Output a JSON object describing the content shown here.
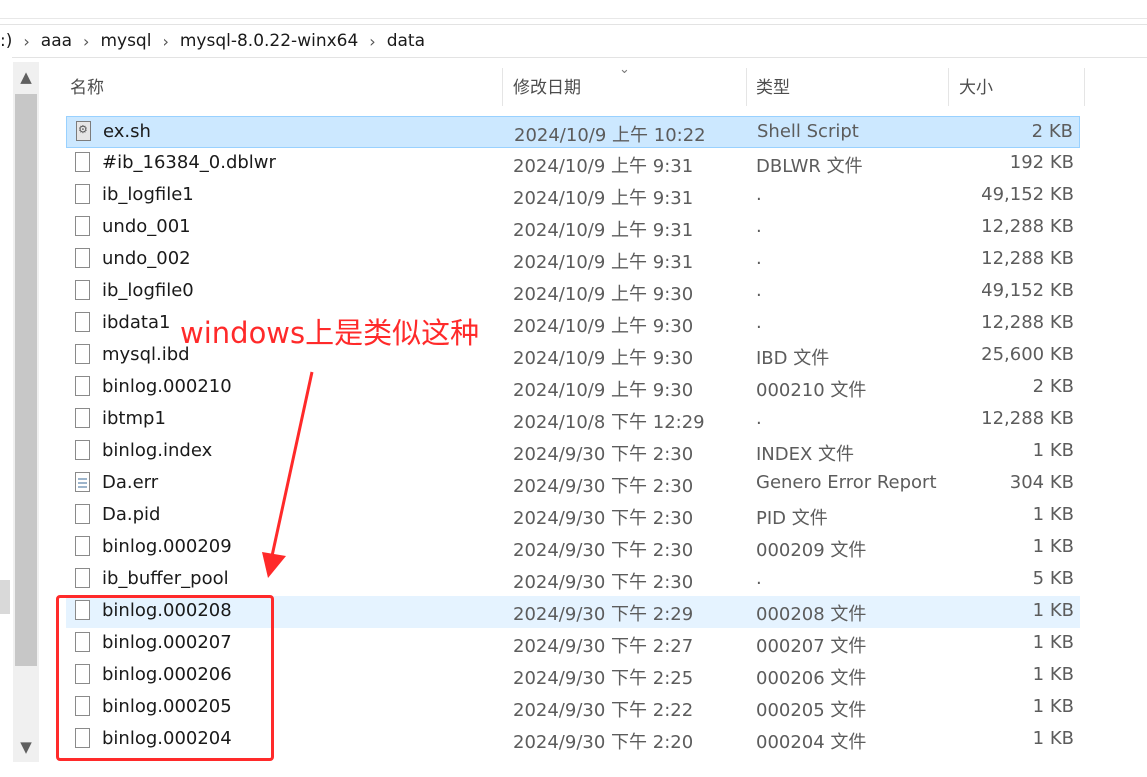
{
  "breadcrumb": {
    "start": ":)",
    "parts": [
      "aaa",
      "mysql",
      "mysql-8.0.22-winx64",
      "data"
    ]
  },
  "columns": {
    "name": "名称",
    "date": "修改日期",
    "type": "类型",
    "size": "大小"
  },
  "files": [
    {
      "name": "ex.sh",
      "date": "2024/10/9 上午 10:22",
      "type": "Shell Script",
      "size": "2 KB",
      "icon": "script-file-icon",
      "state": "selected"
    },
    {
      "name": "#ib_16384_0.dblwr",
      "date": "2024/10/9 上午 9:31",
      "type": "DBLWR 文件",
      "size": "192 KB",
      "icon": "file-icon"
    },
    {
      "name": "ib_logfile1",
      "date": "2024/10/9 上午 9:31",
      "type": ".",
      "size": "49,152 KB",
      "icon": "file-icon"
    },
    {
      "name": "undo_001",
      "date": "2024/10/9 上午 9:31",
      "type": ".",
      "size": "12,288 KB",
      "icon": "file-icon"
    },
    {
      "name": "undo_002",
      "date": "2024/10/9 上午 9:31",
      "type": ".",
      "size": "12,288 KB",
      "icon": "file-icon"
    },
    {
      "name": "ib_logfile0",
      "date": "2024/10/9 上午 9:30",
      "type": ".",
      "size": "49,152 KB",
      "icon": "file-icon"
    },
    {
      "name": "ibdata1",
      "date": "2024/10/9 上午 9:30",
      "type": ".",
      "size": "12,288 KB",
      "icon": "file-icon"
    },
    {
      "name": "mysql.ibd",
      "date": "2024/10/9 上午 9:30",
      "type": "IBD 文件",
      "size": "25,600 KB",
      "icon": "file-icon"
    },
    {
      "name": "binlog.000210",
      "date": "2024/10/9 上午 9:30",
      "type": "000210 文件",
      "size": "2 KB",
      "icon": "file-icon"
    },
    {
      "name": "ibtmp1",
      "date": "2024/10/8 下午 12:29",
      "type": ".",
      "size": "12,288 KB",
      "icon": "file-icon"
    },
    {
      "name": "binlog.index",
      "date": "2024/9/30 下午 2:30",
      "type": "INDEX 文件",
      "size": "1 KB",
      "icon": "file-icon"
    },
    {
      "name": "Da.err",
      "date": "2024/9/30 下午 2:30",
      "type": "Genero Error Report",
      "size": "304 KB",
      "icon": "text-file-icon"
    },
    {
      "name": "Da.pid",
      "date": "2024/9/30 下午 2:30",
      "type": "PID 文件",
      "size": "1 KB",
      "icon": "file-icon"
    },
    {
      "name": "binlog.000209",
      "date": "2024/9/30 下午 2:30",
      "type": "000209 文件",
      "size": "1 KB",
      "icon": "file-icon"
    },
    {
      "name": "ib_buffer_pool",
      "date": "2024/9/30 下午 2:30",
      "type": ".",
      "size": "5 KB",
      "icon": "file-icon"
    },
    {
      "name": "binlog.000208",
      "date": "2024/9/30 下午 2:29",
      "type": "000208 文件",
      "size": "1 KB",
      "icon": "file-icon",
      "state": "hover"
    },
    {
      "name": "binlog.000207",
      "date": "2024/9/30 下午 2:27",
      "type": "000207 文件",
      "size": "1 KB",
      "icon": "file-icon"
    },
    {
      "name": "binlog.000206",
      "date": "2024/9/30 下午 2:25",
      "type": "000206 文件",
      "size": "1 KB",
      "icon": "file-icon"
    },
    {
      "name": "binlog.000205",
      "date": "2024/9/30 下午 2:22",
      "type": "000205 文件",
      "size": "1 KB",
      "icon": "file-icon"
    },
    {
      "name": "binlog.000204",
      "date": "2024/9/30 下午 2:20",
      "type": "000204 文件",
      "size": "1 KB",
      "icon": "file-icon"
    }
  ],
  "annotation": {
    "text": "windows上是类似这种",
    "color": "#ff2a2a"
  },
  "colors": {
    "selected_row": "#cce8ff",
    "hover_row": "#e5f3ff"
  }
}
